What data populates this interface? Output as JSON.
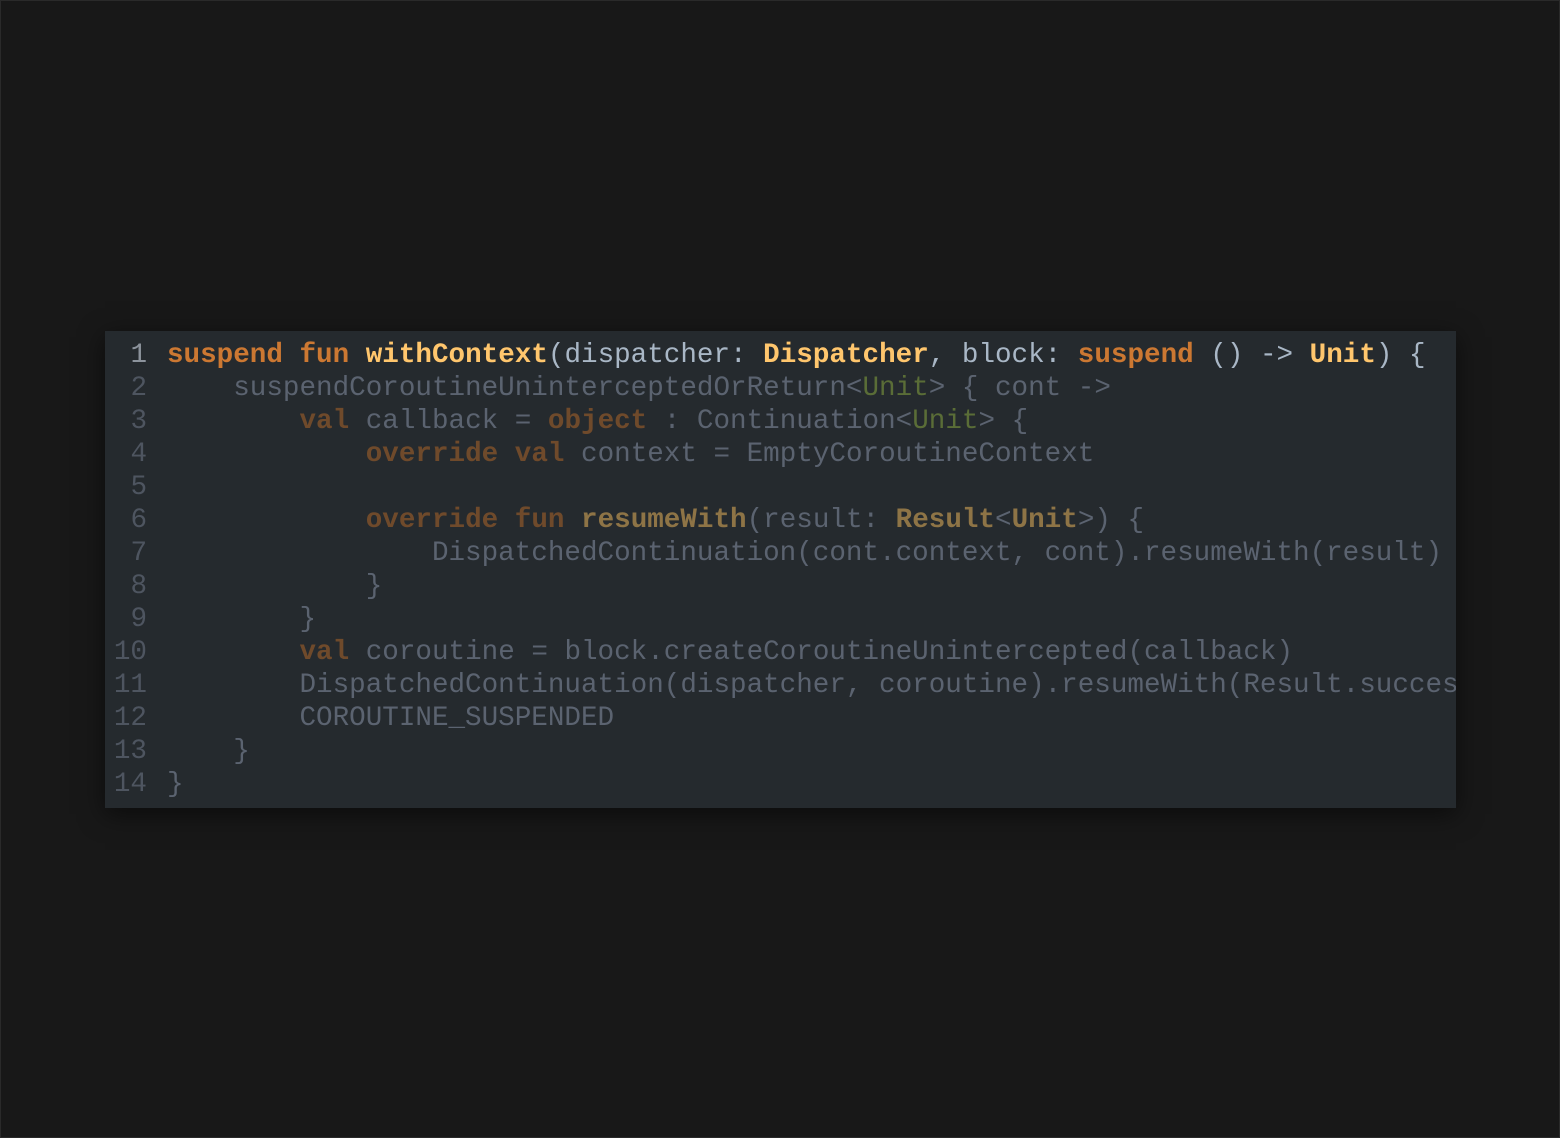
{
  "editor": {
    "background": "#181818",
    "panel_background": "#252a2e",
    "colors": {
      "keyword": "#cc7832",
      "function": "#ffc66d",
      "type": "#ffc66d",
      "generic": "#9bb85a",
      "text": "#a9b7c6",
      "dim_text": "#5b6370",
      "line_number": "#4e5560"
    },
    "lines": [
      {
        "number": "1",
        "tokens": [
          {
            "t": "suspend",
            "k": "kw"
          },
          {
            "t": " ",
            "k": "txt"
          },
          {
            "t": "fun",
            "k": "kw"
          },
          {
            "t": " ",
            "k": "txt"
          },
          {
            "t": "withContext",
            "k": "fn"
          },
          {
            "t": "(dispatcher: ",
            "k": "txt"
          },
          {
            "t": "Dispatcher",
            "k": "type"
          },
          {
            "t": ", block: ",
            "k": "txt"
          },
          {
            "t": "suspend",
            "k": "kw"
          },
          {
            "t": " () -> ",
            "k": "txt"
          },
          {
            "t": "Unit",
            "k": "type"
          },
          {
            "t": ") {",
            "k": "txt"
          }
        ]
      },
      {
        "number": "2",
        "tokens": [
          {
            "t": "    suspendCoroutineUninterceptedOrReturn<",
            "k": "txt"
          },
          {
            "t": "Unit",
            "k": "gen"
          },
          {
            "t": "> { cont ->",
            "k": "txt"
          }
        ]
      },
      {
        "number": "3",
        "tokens": [
          {
            "t": "        ",
            "k": "txt"
          },
          {
            "t": "val",
            "k": "kw"
          },
          {
            "t": " callback = ",
            "k": "txt"
          },
          {
            "t": "object",
            "k": "kw"
          },
          {
            "t": " : Continuation<",
            "k": "txt"
          },
          {
            "t": "Unit",
            "k": "gen"
          },
          {
            "t": "> {",
            "k": "txt"
          }
        ]
      },
      {
        "number": "4",
        "tokens": [
          {
            "t": "            ",
            "k": "txt"
          },
          {
            "t": "override",
            "k": "kw"
          },
          {
            "t": " ",
            "k": "txt"
          },
          {
            "t": "val",
            "k": "kw"
          },
          {
            "t": " context = EmptyCoroutineContext",
            "k": "txt"
          }
        ]
      },
      {
        "number": "5",
        "tokens": []
      },
      {
        "number": "6",
        "tokens": [
          {
            "t": "            ",
            "k": "txt"
          },
          {
            "t": "override",
            "k": "kw"
          },
          {
            "t": " ",
            "k": "txt"
          },
          {
            "t": "fun",
            "k": "kw"
          },
          {
            "t": " ",
            "k": "txt"
          },
          {
            "t": "resumeWith",
            "k": "fn"
          },
          {
            "t": "(result: ",
            "k": "txt"
          },
          {
            "t": "Result",
            "k": "type"
          },
          {
            "t": "<",
            "k": "txt"
          },
          {
            "t": "Unit",
            "k": "type"
          },
          {
            "t": ">) {",
            "k": "txt"
          }
        ]
      },
      {
        "number": "7",
        "tokens": [
          {
            "t": "                DispatchedContinuation(cont.context, cont).resumeWith(result)",
            "k": "txt"
          }
        ]
      },
      {
        "number": "8",
        "tokens": [
          {
            "t": "            }",
            "k": "txt"
          }
        ]
      },
      {
        "number": "9",
        "tokens": [
          {
            "t": "        }",
            "k": "txt"
          }
        ]
      },
      {
        "number": "10",
        "tokens": [
          {
            "t": "        ",
            "k": "txt"
          },
          {
            "t": "val",
            "k": "kw"
          },
          {
            "t": " coroutine = block.createCoroutineUnintercepted(callback)",
            "k": "txt"
          }
        ]
      },
      {
        "number": "11",
        "tokens": [
          {
            "t": "        DispatchedContinuation(dispatcher, coroutine).resumeWith(Result.succes",
            "k": "txt"
          }
        ]
      },
      {
        "number": "12",
        "tokens": [
          {
            "t": "        COROUTINE_SUSPENDED",
            "k": "txt"
          }
        ]
      },
      {
        "number": "13",
        "tokens": [
          {
            "t": "    }",
            "k": "txt"
          }
        ]
      },
      {
        "number": "14",
        "tokens": [
          {
            "t": "}",
            "k": "txt"
          }
        ]
      }
    ]
  }
}
